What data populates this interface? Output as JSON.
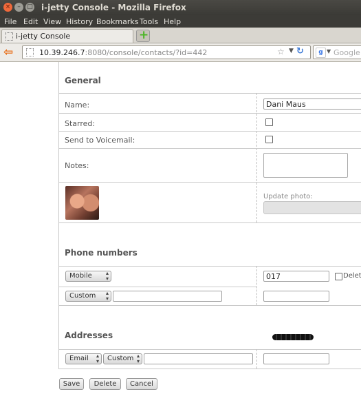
{
  "window": {
    "title": "i-jetty Console - Mozilla Firefox"
  },
  "menu": {
    "file": "File",
    "edit": "Edit",
    "view": "View",
    "history": "History",
    "bookmarks": "Bookmarks",
    "tools": "Tools",
    "help": "Help"
  },
  "tab": {
    "title": "i-jetty Console",
    "new_tab_symbol": "+"
  },
  "address": {
    "host": "10.39.246.7",
    "rest": ":8080/console/contacts/?id=442"
  },
  "search": {
    "placeholder": "Google"
  },
  "general": {
    "title": "General",
    "name_label": "Name:",
    "name_value": "Dani Maus",
    "starred_label": "Starred:",
    "voicemail_label": "Send to Voicemail:",
    "notes_label": "Notes:",
    "update_photo_label": "Update photo:"
  },
  "phones": {
    "title": "Phone numbers",
    "rows": [
      {
        "type": "Mobile",
        "label_value": "",
        "number": "017"
      },
      {
        "type": "Custom",
        "label_value": "",
        "number": ""
      }
    ],
    "delete_label": "Delete"
  },
  "addresses": {
    "title": "Addresses",
    "rows": [
      {
        "kind": "Email",
        "type": "Custom",
        "label_value": "",
        "value": ""
      }
    ]
  },
  "actions": {
    "save": "Save",
    "delete": "Delete",
    "cancel": "Cancel"
  }
}
